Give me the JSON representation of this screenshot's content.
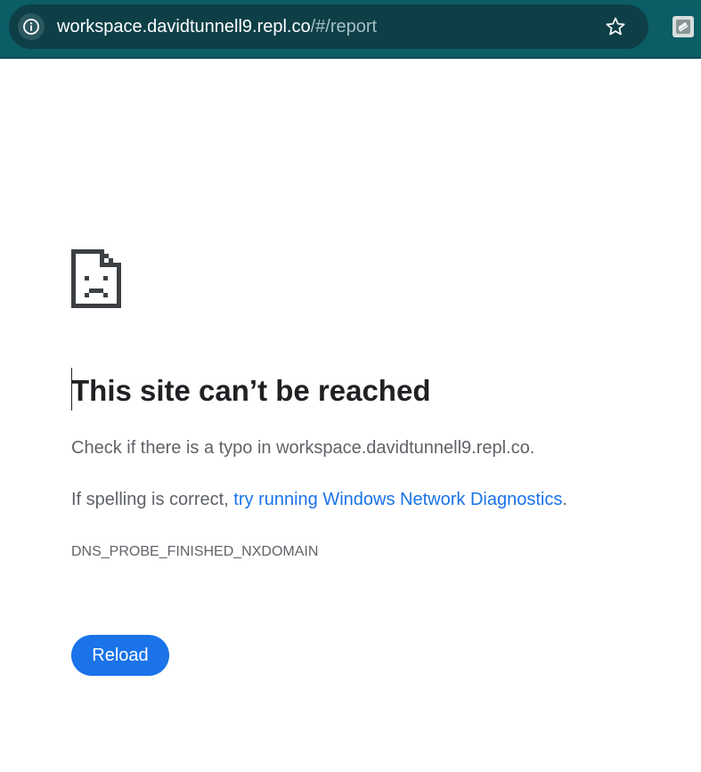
{
  "browser": {
    "url_host": "workspace.davidtunnell9.repl.co",
    "url_path": "/#/report",
    "icons": {
      "site_info": "info-icon",
      "bookmark": "star-icon",
      "extension": "extension-icon"
    },
    "toolbar_color": "#0b5d66"
  },
  "error_page": {
    "icon": "sad-page-icon",
    "headline": "This site can’t be reached",
    "typo_message": "Check if there is a typo in workspace.davidtunnell9.repl.co.",
    "spelling_prefix": "If spelling is correct, ",
    "diagnostics_link": "try running Windows Network Diagnostics",
    "spelling_suffix": ".",
    "error_code": "DNS_PROBE_FINISHED_NXDOMAIN",
    "reload_label": "Reload",
    "accent_color": "#1a73e8"
  }
}
